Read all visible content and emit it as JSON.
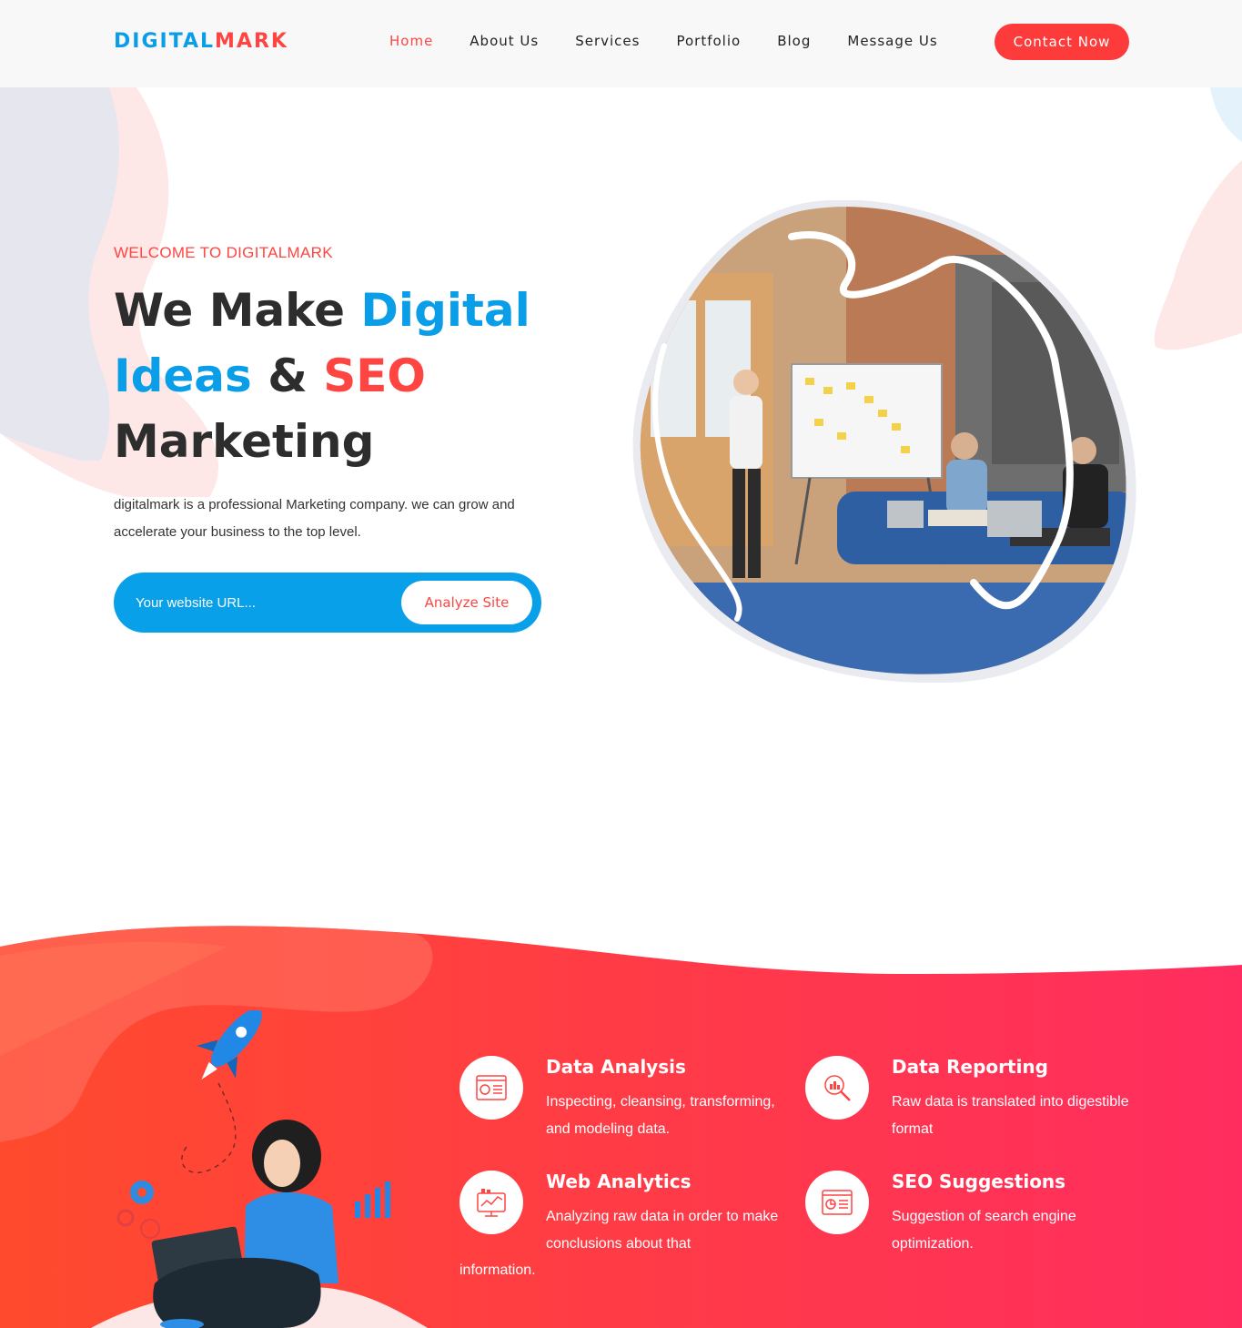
{
  "header": {
    "logo_part1": "DIGITAL",
    "logo_part2": "MARK",
    "nav": [
      "Home",
      "About Us",
      "Services",
      "Portfolio",
      "Blog",
      "Message Us"
    ],
    "active_nav": "Home",
    "contact_label": "Contact Now"
  },
  "hero": {
    "welcome": "WELCOME TO DIGITALMARK",
    "headline": {
      "part1": "We Make ",
      "part2": "Digital",
      "part3": "Ideas",
      "part4": " & ",
      "part5": "SEO",
      "part6": "Marketing"
    },
    "description": "digitalmark is a professional Marketing company. we can grow and accelerate your business to the top level.",
    "search_placeholder": "Your website URL...",
    "analyze_label": "Analyze Site"
  },
  "features": [
    {
      "title": "Data Analysis",
      "description": "Inspecting, cleansing, transforming, and modeling data.",
      "icon": "data-analysis-icon"
    },
    {
      "title": "Data Reporting",
      "description": "Raw data is translated into digestible format",
      "icon": "data-reporting-icon"
    },
    {
      "title": "Web Analytics",
      "description": "Analyzing raw data in order to make conclusions about that",
      "overflow": "information.",
      "icon": "web-analytics-icon"
    },
    {
      "title": "SEO Suggestions",
      "description": "Suggestion of search engine optimization.",
      "icon": "seo-suggestions-icon"
    }
  ],
  "colors": {
    "brand_blue": "#0a9ee8",
    "brand_red": "#fe4542",
    "band_gradient_start": "#ff4a2d",
    "band_gradient_end": "#ff2d5f"
  }
}
